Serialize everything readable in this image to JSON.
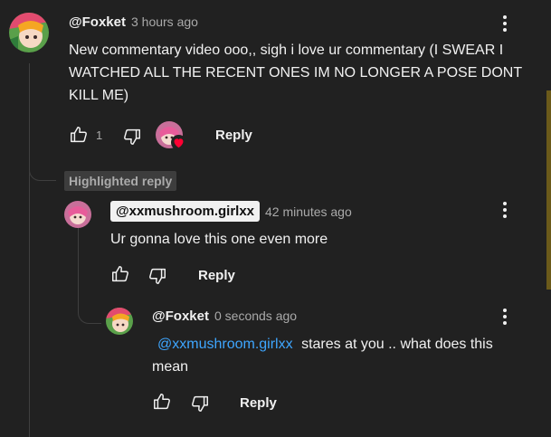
{
  "comments": [
    {
      "author": "@Foxket",
      "time": "3 hours ago",
      "text": "New commentary video ooo,, sigh i love ur commentary (I SWEAR I WATCHED ALL THE RECENT ONES IM NO LONGER A POSE DONT KILL ME)",
      "likes": "1",
      "reply_label": "Reply"
    }
  ],
  "highlighted_label": "Highlighted reply",
  "replies": [
    {
      "author": "@xxmushroom.girlxx",
      "time": "42 minutes ago",
      "text": "Ur gonna love this one even more",
      "reply_label": "Reply"
    },
    {
      "author": "@Foxket",
      "time": "0 seconds ago",
      "mention": "@xxmushroom.girlxx",
      "text": "stares at you .. what does this mean",
      "reply_label": "Reply"
    }
  ],
  "colors": {
    "accent_link": "#3ea6ff",
    "background": "#212121",
    "heart": "#ff0033"
  }
}
